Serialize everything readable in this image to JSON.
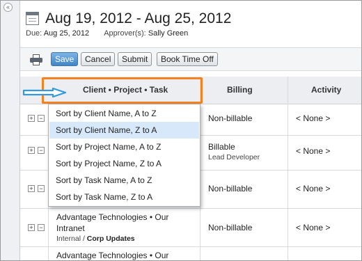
{
  "header": {
    "title": "Aug 19, 2012 - Aug 25, 2012",
    "due_label": "Due:",
    "due_value": "Aug 25, 2012",
    "approver_label": "Approver(s):",
    "approver_value": "Sally Green"
  },
  "toolbar": {
    "save_label": "Save",
    "cancel_label": "Cancel",
    "submit_label": "Submit",
    "book_label": "Book Time Off"
  },
  "table": {
    "columns": [
      "Client • Project • Task",
      "Billing",
      "Activity"
    ],
    "rows": [
      {
        "billing": "Non-billable",
        "activity": "< None >"
      },
      {
        "billing": "Billable",
        "billing_sub": "Lead Developer",
        "activity": "< None >"
      },
      {
        "billing": "Non-billable",
        "activity": "< None >"
      },
      {
        "client_line1": "Advantage Technologies • Our",
        "client_line2": "Intranet",
        "client_sub_a": "Internal / ",
        "client_sub_b": "Corp Updates",
        "billing": "Non-billable",
        "activity": "< None >"
      },
      {
        "client_line1": "Advantage Technologies • Our"
      }
    ]
  },
  "sort_menu": {
    "items": [
      "Sort by Client Name, A to Z",
      "Sort by Client Name, Z to A",
      "Sort by Project Name, A to Z",
      "Sort by Project Name, Z to A",
      "Sort by Task Name, A to Z",
      "Sort by Task Name, Z to A"
    ],
    "active_index": 1
  },
  "colors": {
    "highlight": "#f58220",
    "arrow": "#3399dd",
    "primary_button": "#3f86c8",
    "menu_active": "#d7e8fa"
  },
  "icons": [
    "collapse-icon",
    "calendar-icon",
    "print-icon",
    "expand-icon",
    "collapse-row-icon",
    "arrow-icon"
  ]
}
